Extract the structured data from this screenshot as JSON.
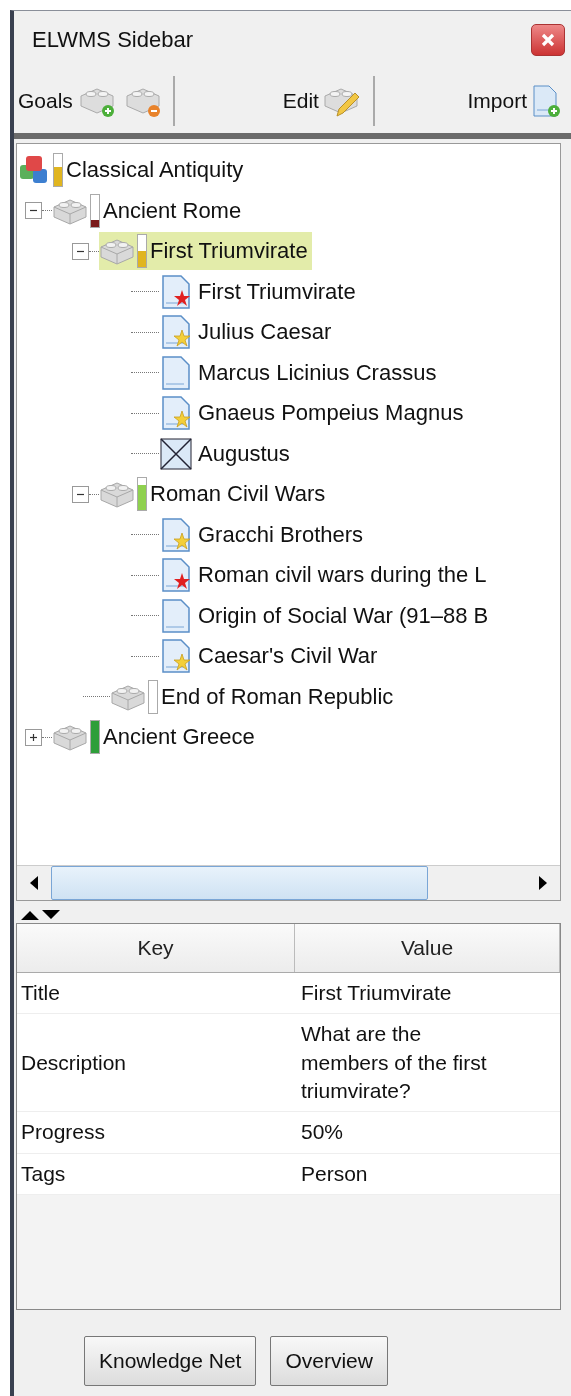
{
  "window": {
    "title": "ELWMS Sidebar"
  },
  "toolbar": {
    "goals_label": "Goals",
    "edit_label": "Edit",
    "import_label": "Import"
  },
  "tree": [
    {
      "kind": "root",
      "label": "Classical Antiquity",
      "level": 0.6,
      "selected": false,
      "children": [
        {
          "kind": "goal",
          "label": "Ancient Rome",
          "level": 0.2,
          "expanded": true,
          "selected": false,
          "children": [
            {
              "kind": "goal",
              "label": "First Triumvirate",
              "level": 0.5,
              "expanded": true,
              "selected": true,
              "children": [
                {
                  "kind": "keydoc",
                  "label": "First Triumvirate",
                  "selected": false
                },
                {
                  "kind": "stardoc",
                  "label": "Julius Caesar",
                  "selected": false
                },
                {
                  "kind": "doc",
                  "label": "Marcus Licinius Crassus",
                  "selected": false
                },
                {
                  "kind": "stardoc",
                  "label": "Gnaeus Pompeius Magnus",
                  "selected": false
                },
                {
                  "kind": "crossed",
                  "label": "Augustus",
                  "selected": false
                }
              ]
            },
            {
              "kind": "goal",
              "label": "Roman Civil Wars",
              "level": 0.8,
              "expanded": true,
              "selected": false,
              "children": [
                {
                  "kind": "stardoc",
                  "label": "Gracchi Brothers",
                  "selected": false
                },
                {
                  "kind": "keydoc",
                  "label": "Roman civil wars during the L",
                  "selected": false
                },
                {
                  "kind": "doc",
                  "label": "Origin of Social War (91–88 B",
                  "selected": false
                },
                {
                  "kind": "stardoc",
                  "label": "Caesar's Civil War",
                  "selected": false
                }
              ]
            },
            {
              "kind": "goal",
              "label": "End of Roman Republic",
              "level": 0,
              "selected": false
            }
          ]
        },
        {
          "kind": "goal",
          "label": "Ancient Greece",
          "level": 1,
          "expanded": false,
          "selected": false
        }
      ]
    }
  ],
  "properties": {
    "columns": [
      "Key",
      "Value"
    ],
    "rows": [
      {
        "key": "Title",
        "value": "First Triumvirate"
      },
      {
        "key": "Description",
        "value": "What are the members of the first triumvirate?"
      },
      {
        "key": "Progress",
        "value": "50%"
      },
      {
        "key": "Tags",
        "value": "Person"
      }
    ]
  },
  "buttons": [
    "Knowledge Net",
    "Overview"
  ]
}
